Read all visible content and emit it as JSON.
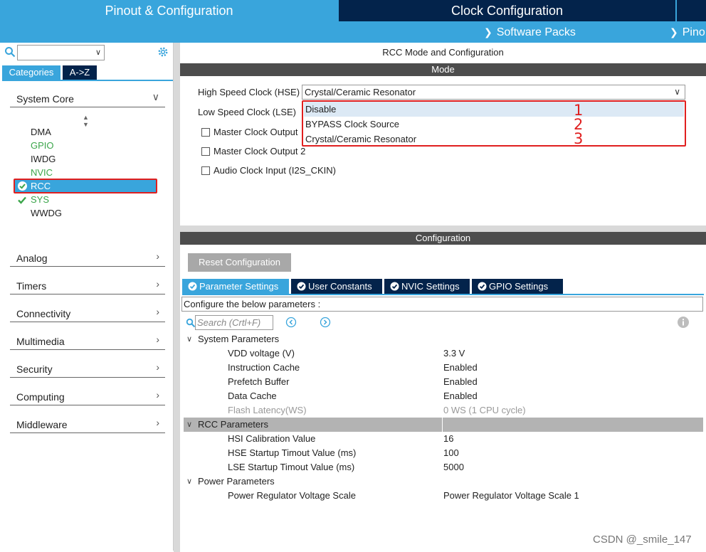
{
  "topbar": {
    "tabs": [
      "Pinout & Configuration",
      "Clock Configuration"
    ],
    "subnav": {
      "software_packs": "Software Packs",
      "pinout": "Pino"
    }
  },
  "left": {
    "category_tabs": [
      "Categories",
      "A->Z"
    ],
    "groups": {
      "system_core": "System Core",
      "analog": "Analog",
      "timers": "Timers",
      "connectivity": "Connectivity",
      "multimedia": "Multimedia",
      "security": "Security",
      "computing": "Computing",
      "middleware": "Middleware"
    },
    "system_core_items": {
      "dma": "DMA",
      "gpio": "GPIO",
      "iwdg": "IWDG",
      "nvic": "NVIC",
      "rcc": "RCC",
      "sys": "SYS",
      "wwdg": "WWDG"
    }
  },
  "mode": {
    "title": "RCC Mode and Configuration",
    "bar": "Mode",
    "hse_label": "High Speed Clock (HSE)",
    "hse_value": "Crystal/Ceramic Resonator",
    "lse_label": "Low Speed Clock (LSE)",
    "options": [
      "Disable",
      "BYPASS Clock Source",
      "Crystal/Ceramic Resonator"
    ],
    "annotations": [
      "1",
      "2",
      "3"
    ],
    "checkboxes": [
      "Master Clock Output",
      "Master Clock Output 2",
      "Audio Clock Input (I2S_CKIN)"
    ]
  },
  "config": {
    "bar": "Configuration",
    "reset_label": "Reset Configuration",
    "tabs": [
      "Parameter Settings",
      "User Constants",
      "NVIC Settings",
      "GPIO Settings"
    ],
    "hint": "Configure the below parameters :",
    "search_placeholder": "Search (Crtl+F)",
    "groups": {
      "system": "System Parameters",
      "rcc": "RCC Parameters",
      "power": "Power Parameters"
    },
    "system_params": [
      {
        "name": "VDD voltage (V)",
        "value": "3.3 V"
      },
      {
        "name": "Instruction Cache",
        "value": "Enabled"
      },
      {
        "name": "Prefetch Buffer",
        "value": "Enabled"
      },
      {
        "name": "Data Cache",
        "value": "Enabled"
      },
      {
        "name": "Flash Latency(WS)",
        "value": "0 WS (1 CPU cycle)"
      }
    ],
    "rcc_params": [
      {
        "name": "HSI Calibration Value",
        "value": "16"
      },
      {
        "name": "HSE Startup Timout Value (ms)",
        "value": "100"
      },
      {
        "name": "LSE Startup Timout Value (ms)",
        "value": "5000"
      }
    ],
    "power_params": [
      {
        "name": "Power Regulator Voltage Scale",
        "value": "Power Regulator Voltage Scale 1"
      }
    ]
  },
  "watermark": "CSDN @_smile_147",
  "colors": {
    "accent": "#39a5dc",
    "dark": "#03234b",
    "highlight_border": "#e01f1f",
    "enabled_green": "#3ba54a"
  }
}
